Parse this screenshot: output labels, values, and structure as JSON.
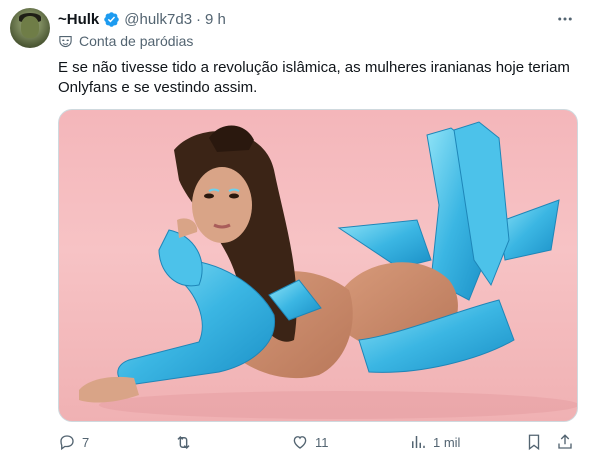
{
  "tweet": {
    "display_name": "~Hulk",
    "handle": "@hulk7d3",
    "separator": "·",
    "time": "9 h",
    "parody_label": "Conta de paródias",
    "text": "E se não tivesse tido a revolução islâmica, as mulheres iranianas hoje teriam Onlyfans e se vestindo assim."
  },
  "actions": {
    "replies": "7",
    "retweets": "",
    "likes": "11",
    "views": "1 mil"
  },
  "colors": {
    "verified": "#1d9bf0",
    "muted": "#536471",
    "text": "#0f1419",
    "border": "#cfd9de"
  },
  "icons": [
    "more-icon",
    "verified-badge-icon",
    "parody-mask-icon",
    "reply-icon",
    "retweet-icon",
    "like-icon",
    "views-icon",
    "bookmark-icon",
    "share-icon"
  ]
}
